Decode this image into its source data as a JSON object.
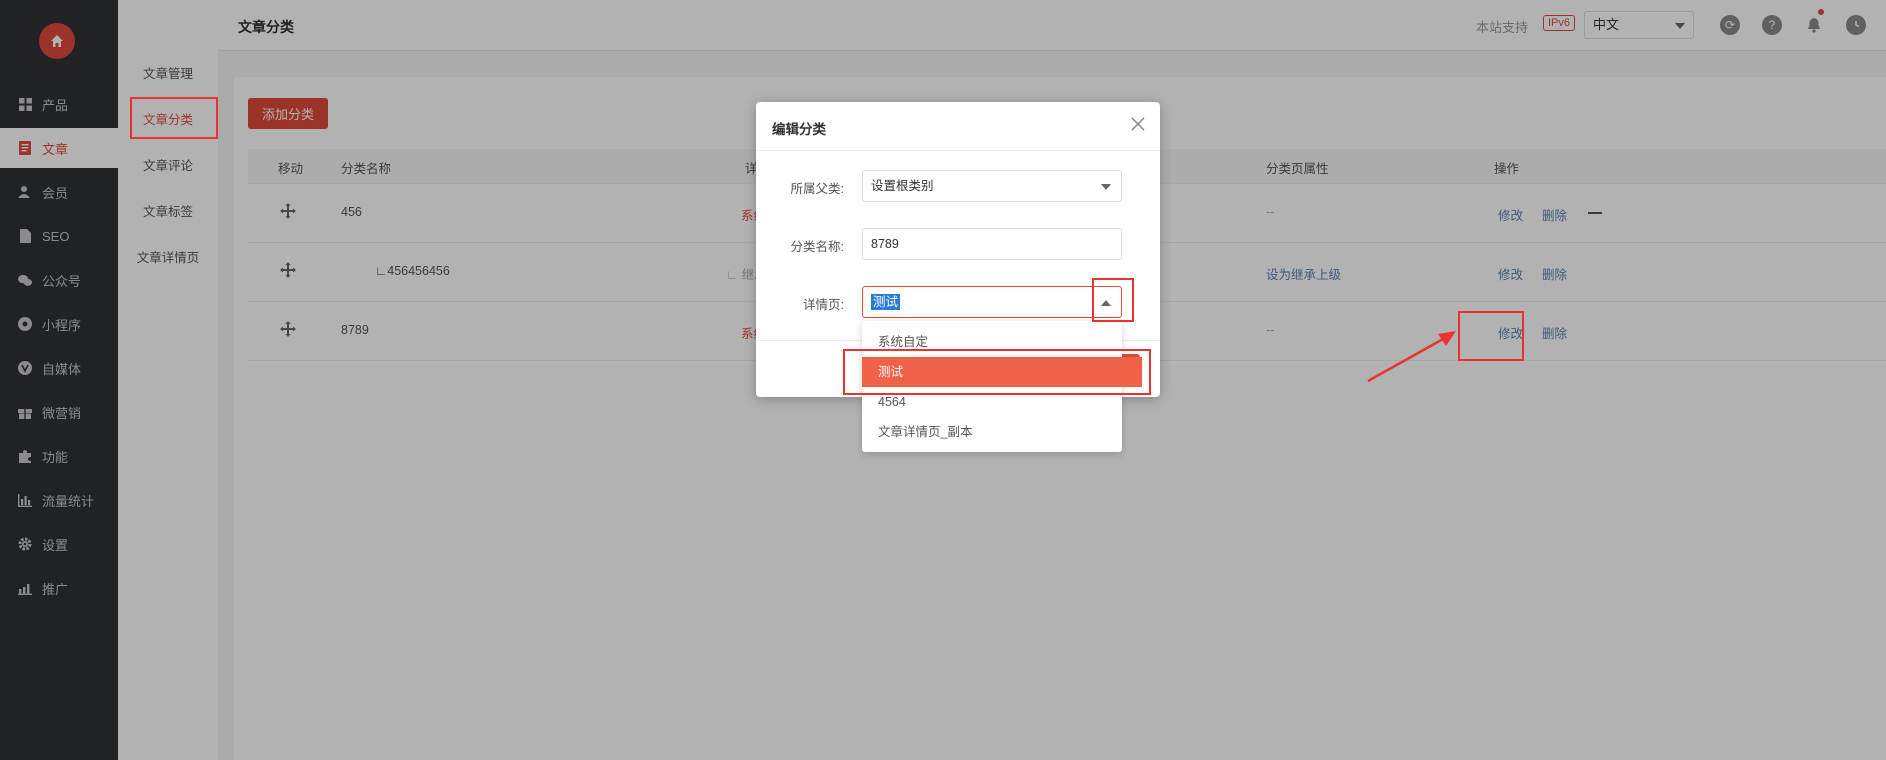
{
  "sidebar": {
    "logo_icon": "home-icon",
    "items": [
      {
        "label": "产品",
        "icon": "grid-icon"
      },
      {
        "label": "文章",
        "icon": "document-icon"
      },
      {
        "label": "会员",
        "icon": "user-icon"
      },
      {
        "label": "SEO",
        "icon": "file-icon"
      },
      {
        "label": "公众号",
        "icon": "wechat-icon"
      },
      {
        "label": "小程序",
        "icon": "miniprogram-icon"
      },
      {
        "label": "自媒体",
        "icon": "media-icon"
      },
      {
        "label": "微营销",
        "icon": "gift-icon"
      },
      {
        "label": "功能",
        "icon": "puzzle-icon"
      },
      {
        "label": "流量统计",
        "icon": "bar-chart-icon"
      },
      {
        "label": "设置",
        "icon": "gear-icon"
      },
      {
        "label": "推广",
        "icon": "trend-icon"
      }
    ],
    "active_index": 1
  },
  "submenu": {
    "items": [
      "文章管理",
      "文章分类",
      "文章评论",
      "文章标签",
      "文章详情页"
    ],
    "active_index": 1
  },
  "topbar": {
    "title": "文章分类",
    "support": "本站支持",
    "ipv6": "IPv6",
    "language": "中文"
  },
  "content": {
    "add_button": "添加分类",
    "columns": {
      "move": "移动",
      "name": "分类名称",
      "detail": "详情",
      "attr": "分类页属性",
      "ops": "操作"
    },
    "rows": [
      {
        "name": "456",
        "detail": "系统",
        "attr": "--",
        "edit": "修改",
        "delete": "删除"
      },
      {
        "name": "∟456456456",
        "detail": "∟ 继承上",
        "attr": "设为继承上级",
        "edit": "修改",
        "delete": "删除"
      },
      {
        "name": "8789",
        "detail": "系统",
        "attr": "--",
        "edit": "修改",
        "delete": "删除"
      }
    ]
  },
  "modal": {
    "title": "编辑分类",
    "parent_label": "所属父类:",
    "parent_value": "设置根类别",
    "name_label": "分类名称:",
    "name_value": "8789",
    "detail_label": "详情页:",
    "detail_value": "测试"
  },
  "dropdown": {
    "options": [
      "系统自定",
      "测试",
      "4564",
      "文章详情页_副本"
    ],
    "selected_index": 1
  },
  "colors": {
    "accent": "#e0493a",
    "sidebar_bg": "#2f3136",
    "annotation": "#e8342d",
    "option_selected": "#f06248"
  }
}
